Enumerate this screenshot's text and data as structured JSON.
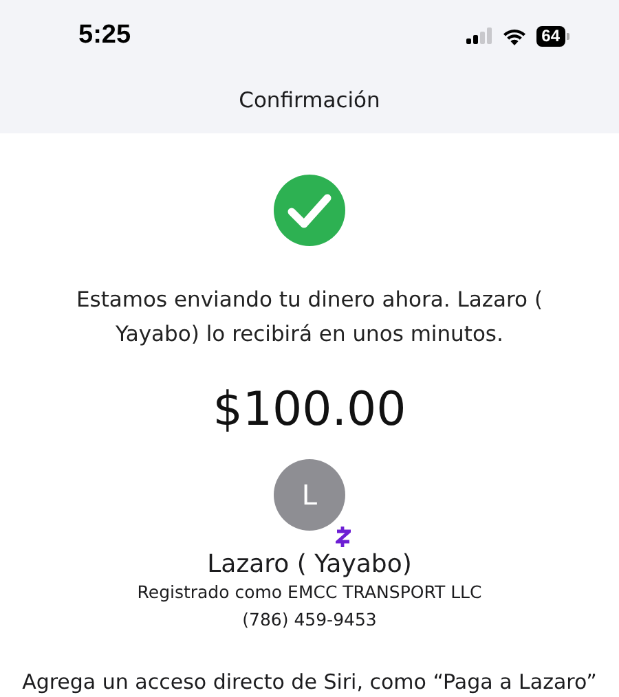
{
  "status_bar": {
    "time": "5:25",
    "battery": "64"
  },
  "header": {
    "title": "Confirmación"
  },
  "message": "Estamos enviando tu dinero ahora. Lazaro ( Yayabo) lo recibirá en unos minutos.",
  "amount": "$100.00",
  "recipient": {
    "initial": "L",
    "name": "Lazaro ( Yayabo)",
    "registered": "Registrado como EMCC TRANSPORT LLC",
    "phone": "(786) 459-9453"
  },
  "siri_hint": "Agrega un acceso directo de Siri, como “Paga a Lazaro”"
}
